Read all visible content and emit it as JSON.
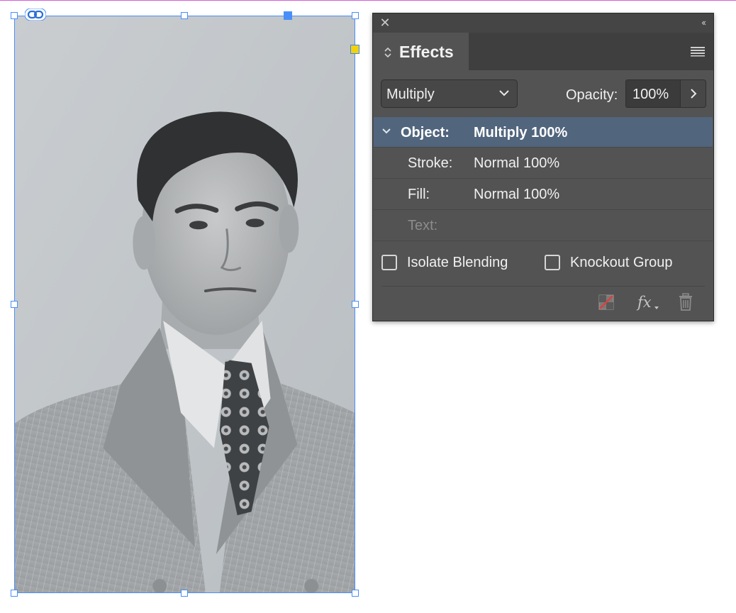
{
  "panel": {
    "title": "Effects",
    "close_glyph": "✕",
    "collapse_glyph": "‹‹",
    "blend_mode": "Multiply",
    "opacity_label": "Opacity:",
    "opacity_value": "100%",
    "rows": [
      {
        "label": "Object:",
        "value": "Multiply 100%",
        "selected": true
      },
      {
        "label": "Stroke:",
        "value": "Normal 100%"
      },
      {
        "label": "Fill:",
        "value": "Normal 100%"
      },
      {
        "label": "Text:",
        "value": "",
        "disabled": true
      }
    ],
    "isolate_blending_label": "Isolate Blending",
    "isolate_blending_checked": false,
    "knockout_group_label": "Knockout Group",
    "knockout_group_checked": false,
    "footer_icons": [
      "clear-effects-icon",
      "fx-icon",
      "trash-icon"
    ]
  },
  "document": {
    "image_subject": "portrait-photo",
    "selection_color": "#4a8ff7",
    "guide_color": "#d85ad8"
  },
  "colors": {
    "panel_bg": "#535353",
    "selected_row": "#51657d",
    "live_corner": "#f2d10d"
  }
}
